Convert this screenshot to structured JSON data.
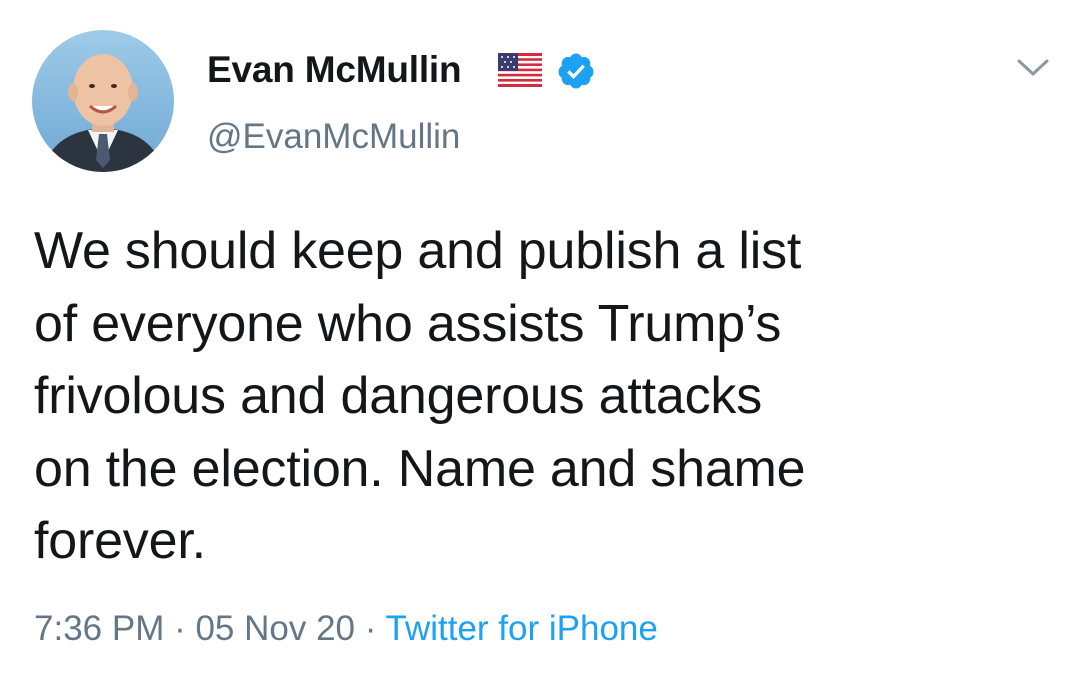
{
  "author": {
    "display_name": "Evan McMullin",
    "handle": "@EvanMcMullin",
    "avatar_icon": "user-avatar-photo",
    "flag_icon": "us-flag-emoji",
    "verified_icon": "verified-badge-icon"
  },
  "tweet": {
    "text": "We should keep and publish a list\nof everyone who assists Trump’s\nfrivolous and dangerous attacks\non the election. Name and shame\nforever.",
    "time": "7:36 PM",
    "separator": " · ",
    "date": "05 Nov 20",
    "source": "Twitter for iPhone"
  },
  "menu": {
    "caret_icon": "chevron-down-icon"
  },
  "colors": {
    "text": "#14171a",
    "secondary": "#657786",
    "link": "#1da1f2",
    "verified": "#1da1f2"
  }
}
